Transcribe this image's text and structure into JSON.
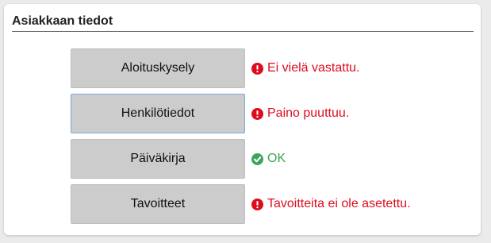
{
  "panel": {
    "title": "Asiakkaan tiedot"
  },
  "colors": {
    "error": "#dd0d1f",
    "ok": "#3ba55c"
  },
  "items": [
    {
      "label": "Aloituskysely",
      "status_text": "Ei vielä vastattu.",
      "status": "error",
      "icon": "exclamation-circle-icon"
    },
    {
      "label": "Henkilötiedot",
      "status_text": "Paino puuttuu.",
      "status": "error",
      "icon": "exclamation-circle-icon"
    },
    {
      "label": "Päiväkirja",
      "status_text": "OK",
      "status": "ok",
      "icon": "check-circle-icon"
    },
    {
      "label": "Tavoitteet",
      "status_text": "Tavoitteita ei ole asetettu.",
      "status": "error",
      "icon": "exclamation-circle-icon"
    }
  ]
}
